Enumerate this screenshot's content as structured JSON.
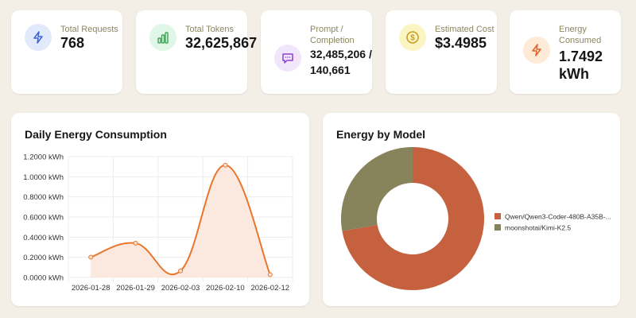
{
  "stats": [
    {
      "label": "Total Requests",
      "value": "768",
      "icon": "lightning-icon",
      "bg": "#e1eafb",
      "fg": "#3b63d6"
    },
    {
      "label": "Total Tokens",
      "value": "32,625,867",
      "icon": "bar-chart-icon",
      "bg": "#e0f6e6",
      "fg": "#3fa454"
    },
    {
      "label": "Prompt / Completion",
      "value": "32,485,206 / 140,661",
      "icon": "chat-icon",
      "bg": "#f1e6fb",
      "fg": "#9040d0"
    },
    {
      "label": "Estimated Cost",
      "value": "$3.4985",
      "icon": "dollar-coin-icon",
      "bg": "#fbf5c4",
      "fg": "#c99a1d"
    },
    {
      "label": "Energy Consumed",
      "value": "1.7492 kWh",
      "icon": "lightning-icon",
      "bg": "#fdebd8",
      "fg": "#e2622a"
    }
  ],
  "chart_data": [
    {
      "type": "line",
      "title": "Daily Energy Consumption",
      "categories": [
        "2026-01-28",
        "2026-01-29",
        "2026-02-03",
        "2026-02-10",
        "2026-02-12"
      ],
      "values": [
        0.2016,
        0.34,
        0.065,
        1.115,
        0.028
      ],
      "ylim": [
        0,
        1.2
      ],
      "yticks": [
        "0.0000 kWh",
        "0.2000 kWh",
        "0.4000 kWh",
        "0.6000 kWh",
        "0.8000 kWh",
        "1.0000 kWh",
        "1.2000 kWh"
      ],
      "grid": true,
      "smooth": true,
      "fill": true,
      "color": "#e8762c",
      "fillColor": "#fbe9e0"
    },
    {
      "type": "pie",
      "donut": true,
      "title": "Energy by Model",
      "legend_position": "right",
      "labels": [
        "Qwen/Qwen3-Coder-480B-A35B-...",
        "moonshotai/Kimi-K2.5"
      ],
      "values": [
        1.263,
        0.486
      ],
      "colors": [
        "#c5613e",
        "#87835b"
      ]
    }
  ]
}
